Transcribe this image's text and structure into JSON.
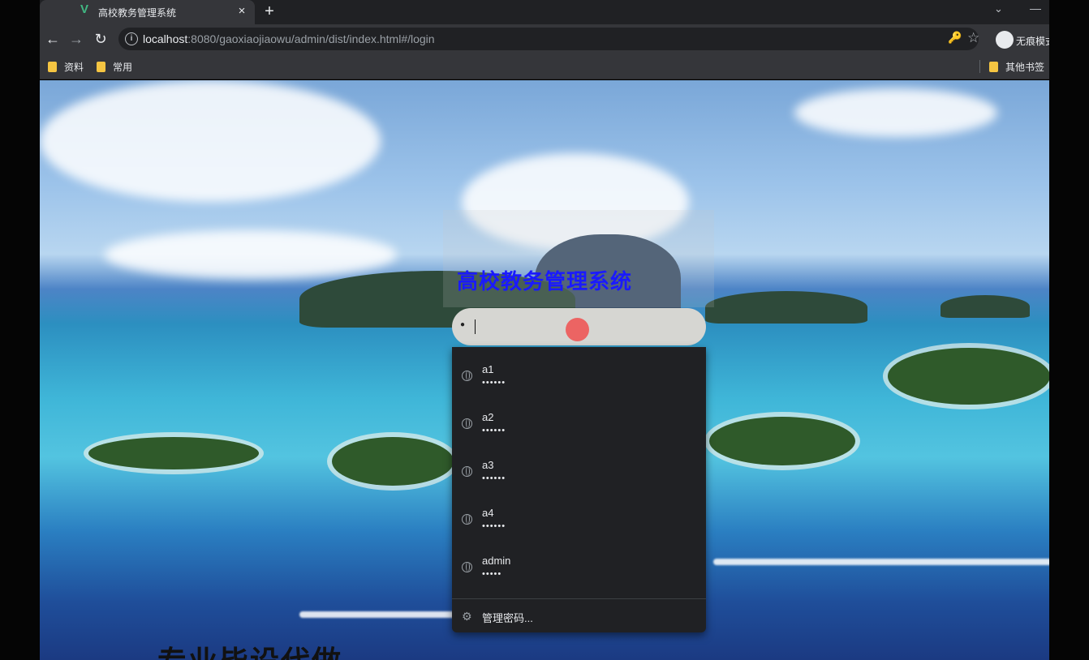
{
  "browser": {
    "tab_title": "高校教务管理系统",
    "tab_close": "×",
    "new_tab": "+",
    "url_host": "localhost",
    "url_rest": ":8080/gaoxiaojiaowu/admin/dist/index.html#/login",
    "profile_label": "无痕模式",
    "bookmarks": [
      "资料",
      "常用"
    ],
    "other_bookmarks": "其他书签"
  },
  "icons": {
    "back": "←",
    "forward": "→",
    "reload": "↻",
    "info": "i",
    "key": "🔑",
    "star": "☆",
    "chevron": "⌄",
    "minimize": "—",
    "gear": "⚙",
    "user": "👤"
  },
  "login": {
    "title": "高校教务管理系统",
    "username_value": ""
  },
  "autofill": {
    "accounts": [
      {
        "user": "a1",
        "pass": "••••••"
      },
      {
        "user": "a2",
        "pass": "••••••"
      },
      {
        "user": "a3",
        "pass": "••••••"
      },
      {
        "user": "a4",
        "pass": "••••••"
      },
      {
        "user": "admin",
        "pass": "•••••"
      }
    ],
    "manage_label": "管理密码..."
  },
  "background": {
    "caption": "专业毕设代做"
  }
}
